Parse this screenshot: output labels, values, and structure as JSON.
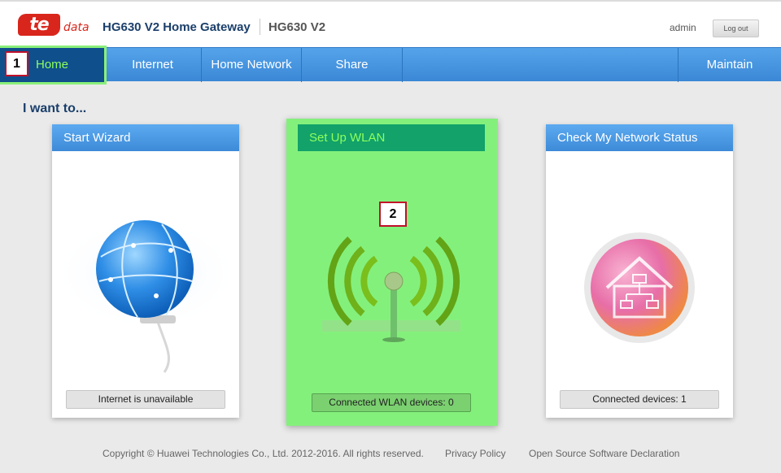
{
  "header": {
    "logo_main": "te",
    "logo_sub": "data",
    "product_title": "HG630 V2 Home Gateway",
    "model": "HG630 V2",
    "username": "admin",
    "logout_label": "Log out"
  },
  "nav": {
    "items": [
      {
        "label": "Home"
      },
      {
        "label": "Internet"
      },
      {
        "label": "Home Network"
      },
      {
        "label": "Share"
      },
      {
        "label": "Maintain"
      }
    ]
  },
  "annotations": {
    "badge1": "1",
    "badge2": "2"
  },
  "main": {
    "heading": "I want to...",
    "cards": [
      {
        "title": "Start Wizard",
        "status": "Internet is unavailable",
        "icon": "globe-icon"
      },
      {
        "title": "Set Up WLAN",
        "status": "Connected WLAN devices: 0",
        "icon": "wifi-icon"
      },
      {
        "title": "Check My Network Status",
        "status": "Connected devices: 1",
        "icon": "home-network-icon"
      }
    ]
  },
  "footer": {
    "copyright": "Copyright © Huawei Technologies Co., Ltd. 2012-2016. All rights reserved.",
    "privacy": "Privacy Policy",
    "opensource": "Open Source Software Declaration"
  },
  "colors": {
    "accent": "#3d8ad8",
    "highlight": "#84f07c",
    "brand": "#d9261c"
  }
}
